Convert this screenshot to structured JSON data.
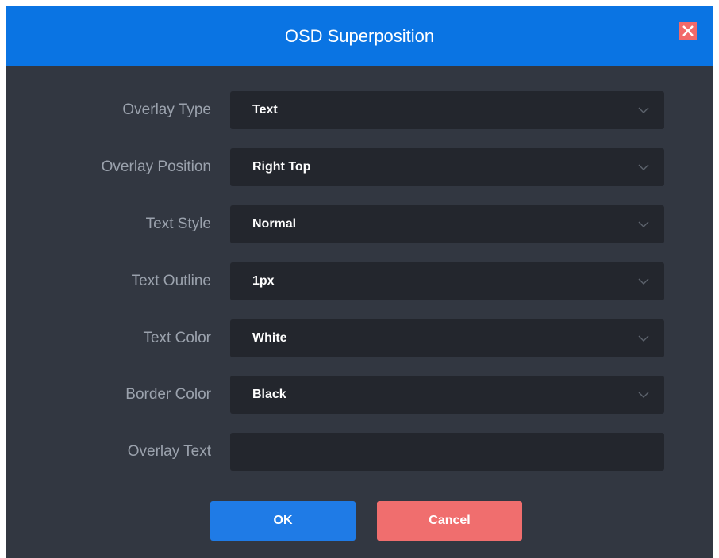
{
  "dialog": {
    "title": "OSD Superposition",
    "close_icon": "close-icon"
  },
  "form": {
    "overlay_type": {
      "label": "Overlay Type",
      "value": "Text"
    },
    "overlay_position": {
      "label": "Overlay Position",
      "value": "Right Top"
    },
    "text_style": {
      "label": "Text Style",
      "value": "Normal"
    },
    "text_outline": {
      "label": "Text Outline",
      "value": "1px"
    },
    "text_color": {
      "label": "Text Color",
      "value": "White"
    },
    "border_color": {
      "label": "Border Color",
      "value": "Black"
    },
    "overlay_text": {
      "label": "Overlay Text",
      "value": ""
    }
  },
  "buttons": {
    "ok_label": "OK",
    "cancel_label": "Cancel"
  },
  "colors": {
    "titlebar": "#0a74e3",
    "dialog_bg": "#323741",
    "field_bg": "#23262d",
    "ok": "#1f7be6",
    "cancel": "#f06e6e"
  }
}
